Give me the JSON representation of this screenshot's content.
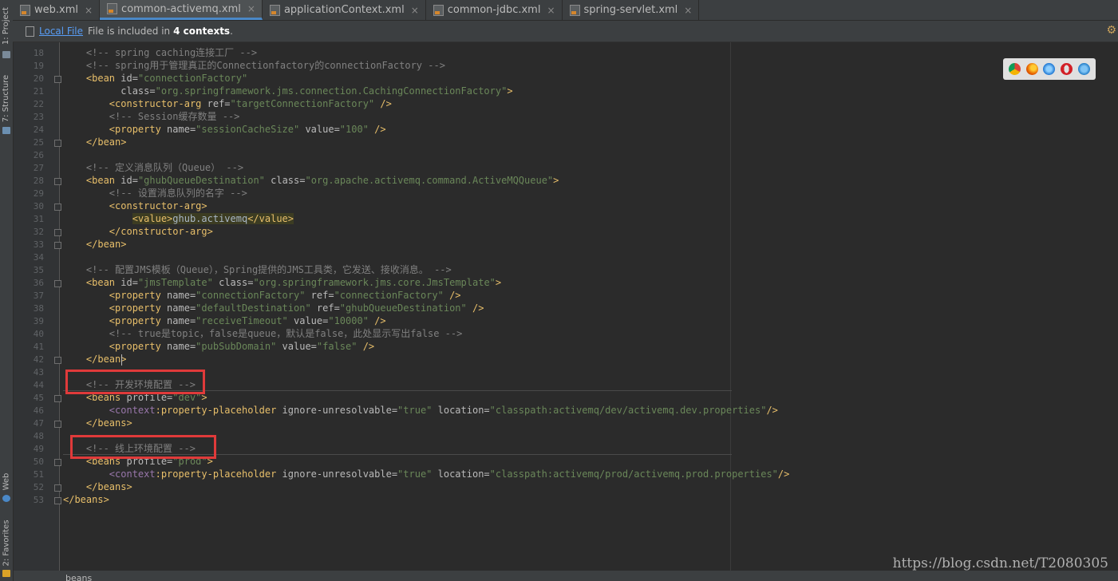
{
  "tool_windows": {
    "project": "1: Project",
    "structure": "7: Structure",
    "web": "Web",
    "favorites": "2: Favorites"
  },
  "tabs": [
    {
      "label": "web.xml",
      "active": false
    },
    {
      "label": "common-activemq.xml",
      "active": true
    },
    {
      "label": "applicationContext.xml",
      "active": false
    },
    {
      "label": "common-jdbc.xml",
      "active": false
    },
    {
      "label": "spring-servlet.xml",
      "active": false
    }
  ],
  "infobar": {
    "link": "Local File",
    "text": "File is included in",
    "count": "4 contexts",
    "period": "."
  },
  "browsers": [
    "chrome-icon",
    "firefox-icon",
    "safari-icon",
    "opera-icon",
    "ie-icon"
  ],
  "line_numbers": [
    "18",
    "19",
    "20",
    "21",
    "22",
    "23",
    "24",
    "25",
    "26",
    "27",
    "28",
    "29",
    "30",
    "31",
    "32",
    "33",
    "34",
    "35",
    "36",
    "37",
    "38",
    "39",
    "40",
    "41",
    "42",
    "43",
    "44",
    "45",
    "46",
    "47",
    "48",
    "49",
    "50",
    "51",
    "52",
    "53"
  ],
  "code": {
    "l18": "<!-- spring caching连接工厂 -->",
    "l19": "<!-- spring用于管理真正的Connectionfactory的connectionFactory -->",
    "l20_id": "\"connectionFactory\"",
    "l21_class": "\"org.springframework.jms.connection.CachingConnectionFactory\"",
    "l22_ref": "\"targetConnectionFactory\"",
    "l23": "<!-- Session缓存数量 -->",
    "l24_name": "\"sessionCacheSize\"",
    "l24_value": "\"100\"",
    "l27": "<!-- 定义消息队列（Queue） -->",
    "l28_id": "\"ghubQueueDestination\"",
    "l28_class": "\"org.apache.activemq.command.ActiveMQQueue\"",
    "l29": "<!-- 设置消息队列的名字 -->",
    "l31_text": "ghub.activemq",
    "l35": "<!-- 配置JMS模板（Queue），Spring提供的JMS工具类，它发送、接收消息。 -->",
    "l36_id": "\"jmsTemplate\"",
    "l36_class": "\"org.springframework.jms.core.JmsTemplate\"",
    "l37_name": "\"connectionFactory\"",
    "l37_ref": "\"connectionFactory\"",
    "l38_name": "\"defaultDestination\"",
    "l38_ref": "\"ghubQueueDestination\"",
    "l39_name": "\"receiveTimeout\"",
    "l39_value": "\"10000\"",
    "l40": "<!-- true是topic，false是queue，默认是false，此处显示写出false -->",
    "l41_name": "\"pubSubDomain\"",
    "l41_value": "\"false\"",
    "l44": "<!-- 开发环境配置 -->",
    "l45_profile": "\"dev\"",
    "l46_ignore": "\"true\"",
    "l46_location": "\"classpath:activemq/dev/activemq.dev.properties\"",
    "l49": "<!-- 线上环境配置 -->",
    "l50_profile": "\"prod\"",
    "l51_ignore": "\"true\"",
    "l51_location": "\"classpath:activemq/prod/activemq.prod.properties\""
  },
  "statusbar": {
    "breadcrumb": "beans"
  },
  "watermark": "https://blog.csdn.net/T2080305"
}
